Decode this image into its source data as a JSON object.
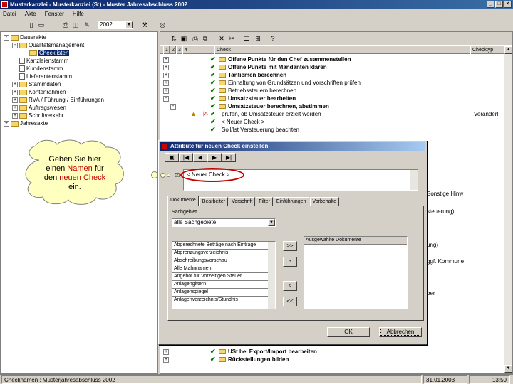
{
  "window": {
    "title": "Musterkanzlei - Musterkanzlei (S:) - Muster Jahresabschluss 2002"
  },
  "menu": [
    "Datei",
    "Akte",
    "Fenster",
    "Hilfe"
  ],
  "toolbar": {
    "year": "2002"
  },
  "tree": {
    "items": [
      {
        "label": "Dauerakte",
        "level": 0,
        "expander": "-"
      },
      {
        "label": "Qualitätsmanagement",
        "level": 1,
        "expander": "-"
      },
      {
        "label": "Checklisten",
        "level": 2,
        "expander": "",
        "selected": true
      },
      {
        "label": "Kanzleienstamm",
        "level": 1,
        "expander": ""
      },
      {
        "label": "Kundenstamm",
        "level": 1,
        "expander": ""
      },
      {
        "label": "Lieferantenstamm",
        "level": 1,
        "expander": ""
      },
      {
        "label": "Stammdaten",
        "level": 1,
        "expander": "+"
      },
      {
        "label": "Kontenrahmen",
        "level": 1,
        "expander": "+"
      },
      {
        "label": "RVA / Führung / Einführungen",
        "level": 1,
        "expander": "+"
      },
      {
        "label": "Auftragswesen",
        "level": 1,
        "expander": "+"
      },
      {
        "label": "Schriftverkehr",
        "level": 1,
        "expander": "+"
      },
      {
        "label": "Jahresakte",
        "level": 0,
        "expander": "+"
      }
    ]
  },
  "grid": {
    "columns": [
      "1",
      "2",
      "3",
      "4",
      "Check",
      "Checktyp"
    ],
    "rows": [
      {
        "text": "Offene Punkte für den Chef zusammenstellen",
        "bold": true,
        "type": ""
      },
      {
        "text": "Offene Punkte mit Mandanten klären",
        "bold": true,
        "type": ""
      },
      {
        "text": "Tantiemen berechnen",
        "bold": true,
        "type": ""
      },
      {
        "text": "Einhaltung von Grundsätzen und Vorschriften prüfen",
        "bold": false,
        "type": ""
      },
      {
        "text": "Betriebssteuern berechnen",
        "bold": false,
        "type": ""
      },
      {
        "text": "Umsatzsteuer bearbeiten",
        "bold": true,
        "type": ""
      },
      {
        "text": "Umsatzsteuer berechnen, abstimmen",
        "bold": true,
        "type": ""
      },
      {
        "text": "prüfen, ob Umsatzsteuer erzielt worden",
        "bold": false,
        "type": "Veränderl"
      },
      {
        "text": "< Neuer Check >",
        "bold": false,
        "type": ""
      },
      {
        "text": "Soll/Ist Versteuerung beachten",
        "bold": false,
        "type": ""
      }
    ],
    "partial_texts": [
      "Sonstige Hinw",
      "steuerung)",
      "ung)",
      "ggf. Kommune",
      "ber"
    ],
    "bottom_rows": [
      {
        "text": "USt bei Export/Import bearbeiten",
        "bold": true
      },
      {
        "text": "Rückstellungen bilden",
        "bold": true
      }
    ]
  },
  "dialog": {
    "title": "Attribute für neuen Check einstellen",
    "name_value": "< Neuer Check >",
    "tabs": [
      "Dokumente",
      "Bearbeiter",
      "Vorschrift",
      "Filter",
      "Einführungen",
      "Vorbehalte"
    ],
    "active_tab": "Dokumente",
    "sachgebiet_label": "Sachgebiet",
    "sachgebiet_value": "alle Sachgebiete",
    "available": [
      "Abgerechnete Beträge nach Eintrage",
      "Abgrenzungsverzeichnis",
      "Abschreibungsvorschau",
      "Alle Mahnnamen",
      "Angebot für Vorzeitigen Steuer",
      "Anlagengittern",
      "Anlagenspiegel",
      "Anlagenverzeichnis/Stundnis"
    ],
    "selected_header": "Ausgewählte Dokumente",
    "move_buttons": [
      ">>",
      ">",
      "<",
      "<<"
    ],
    "ok_label": "OK",
    "cancel_label": "Abbrechen"
  },
  "callout": {
    "line1": "Geben Sie hier",
    "line2_a": "einen ",
    "line2_b": "Namen",
    "line2_c": " für",
    "line3_a": "den ",
    "line3_b": "neuen Check",
    "line4": "ein.",
    "highlight_color": "#c00000"
  },
  "status": {
    "left": "Checknamen : Musterjahresabschluss 2002",
    "date": "31.01.2003",
    "time": "13:50"
  }
}
